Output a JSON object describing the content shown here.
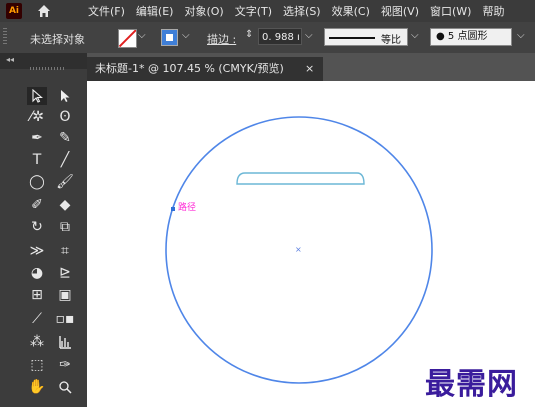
{
  "menubar": {
    "logo": "Ai",
    "items": [
      "文件(F)",
      "编辑(E)",
      "对象(O)",
      "文字(T)",
      "选择(S)",
      "效果(C)",
      "视图(V)",
      "窗口(W)",
      "帮助"
    ]
  },
  "controlbar": {
    "selection_status": "未选择对象",
    "stroke_label": "描边 :",
    "stroke_weight": "0. 988 ı",
    "profile_label": "等比",
    "brush_label": "● 5 点圆形"
  },
  "document": {
    "tab_title": "未标题-1* @ 107.45 % (CMYK/预览)",
    "close_glyph": "×"
  },
  "canvas": {
    "path_label": "路径",
    "center_glyph": "×",
    "watermark": "最需网"
  },
  "colors": {
    "circle_stroke": "#4f86e8",
    "shape_stroke": "#6cb7d6",
    "smart_guide": "#ff2bd6",
    "watermark": "#3a1c9c"
  }
}
